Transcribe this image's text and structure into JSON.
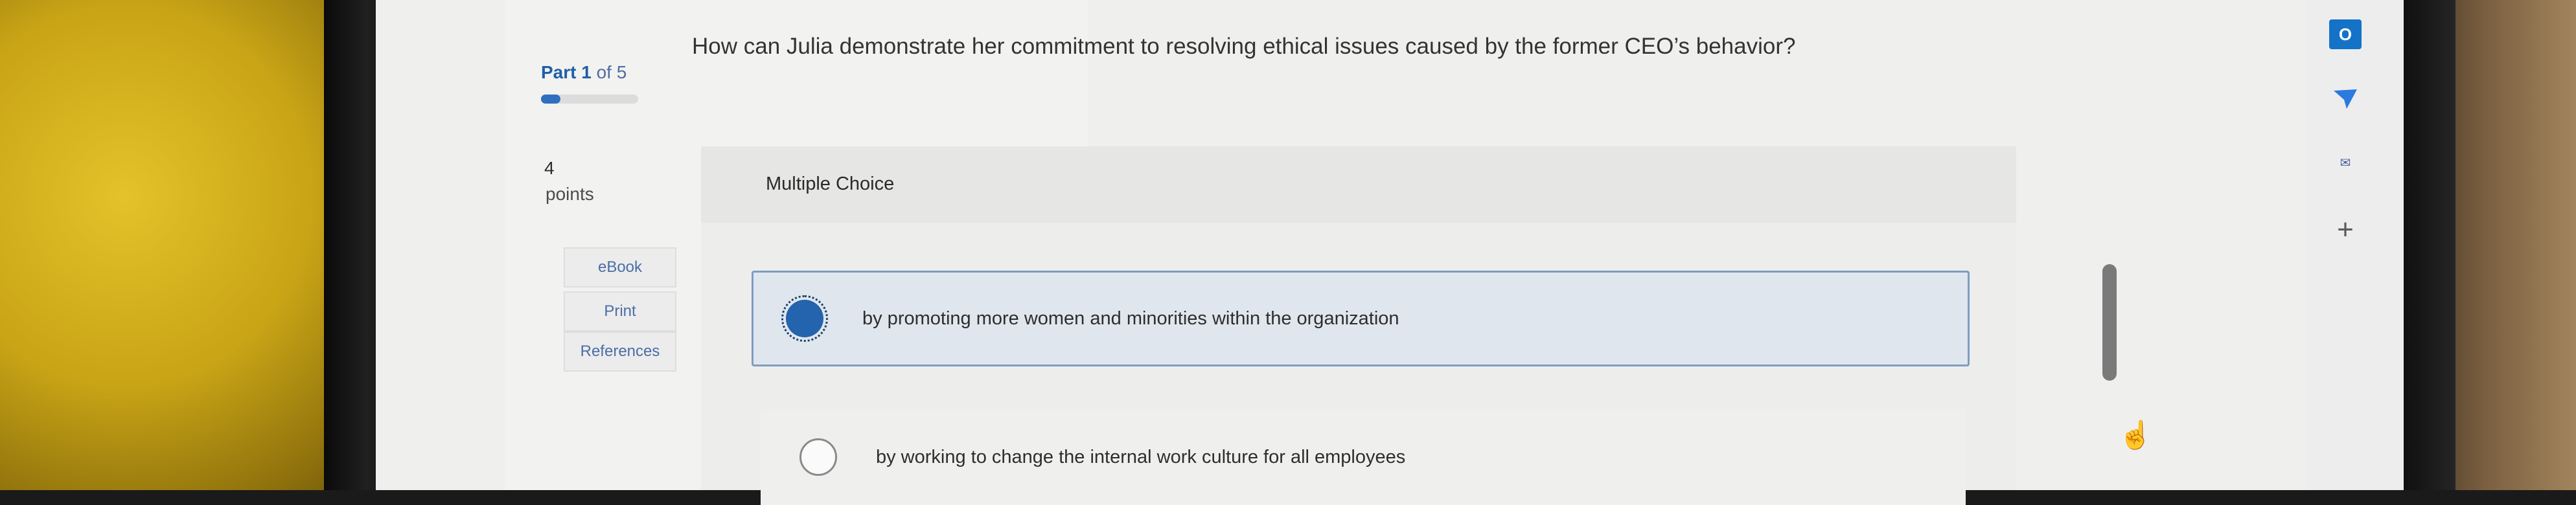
{
  "assessment": {
    "part_current": "Part 1",
    "part_total": " of 5",
    "progress_fraction": 0.2
  },
  "points": {
    "value": "4",
    "label": "points"
  },
  "sidebar": {
    "links": [
      {
        "label": "eBook"
      },
      {
        "label": "Print"
      },
      {
        "label": "References"
      }
    ]
  },
  "question": {
    "text": "How can Julia demonstrate her commitment to resolving ethical issues caused by the former CEO’s behavior?",
    "type_label": "Multiple Choice"
  },
  "choices": [
    {
      "text": "by promoting more women and minorities within the organization",
      "selected": true
    },
    {
      "text": "by working to change the internal work culture for all employees",
      "selected": false
    }
  ],
  "right_bar": {
    "icons": [
      "outlook-icon",
      "send-icon",
      "mail-icon",
      "plus-icon"
    ],
    "outlook_glyph": "O",
    "mail_glyph": "✉",
    "plus_glyph": "+"
  },
  "colors": {
    "accent": "#2463ad",
    "selected_bg": "#dfe6ee"
  }
}
